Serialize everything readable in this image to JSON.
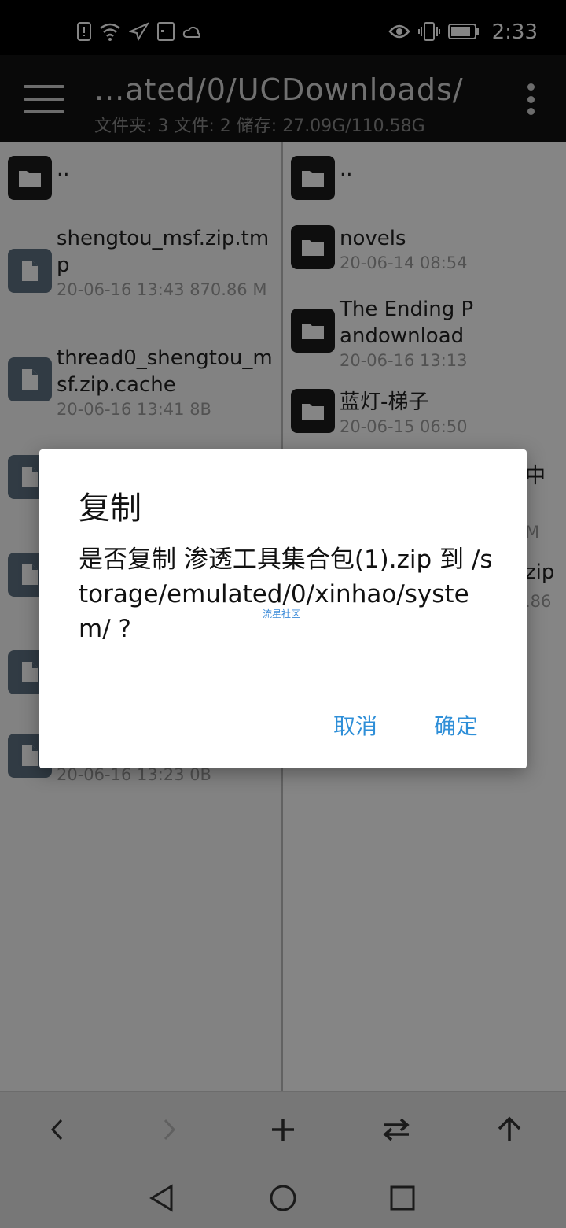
{
  "status_bar": {
    "time": "2:33",
    "left_icons": [
      "alert-icon",
      "wifi-icon",
      "airplane-icon",
      "sim-icon",
      "weather-icon"
    ],
    "right_icons": [
      "eye-icon",
      "vibrate-icon",
      "battery-icon"
    ]
  },
  "toolbar": {
    "path": "...ated/0/UCDownloads/",
    "stats": "文件夹: 3  文件: 2  储存: 27.09G/110.58G"
  },
  "left_pane": {
    "items": [
      {
        "name": "..",
        "meta": "",
        "type": "folder"
      },
      {
        "name": "shengtou_msf.zip.tmp",
        "meta": "20-06-16 13:43  870.86 M",
        "type": "file"
      },
      {
        "name": "thread0_shengtou_msf.zip.cache",
        "meta": "20-06-16 13:41  8B",
        "type": "file"
      },
      {
        "name": "",
        "meta": "",
        "type": "file"
      },
      {
        "name": "",
        "meta": "",
        "type": "file"
      },
      {
        "name": "",
        "meta": "",
        "type": "file"
      },
      {
        "name": "",
        "meta": "20-06-16 13:23  0B",
        "type": "file"
      }
    ]
  },
  "right_pane": {
    "items": [
      {
        "name": "..",
        "meta": "",
        "type": "folder"
      },
      {
        "name": "novels",
        "meta": "20-06-14 08:54",
        "type": "folder"
      },
      {
        "name": "The Ending Pandownload",
        "meta": "20-06-16 13:13",
        "type": "folder"
      },
      {
        "name": "蓝灯-梯子",
        "meta": "20-06-15 06:50",
        "type": "folder"
      }
    ],
    "partial": [
      "中",
      "M",
      "zip",
      ".86"
    ]
  },
  "dialog": {
    "title": "复制",
    "message": "是否复制 渗透工具集合包(1).zip 到 /storage/emulated/0/xinhao/system/ ?",
    "watermark": "流星社区",
    "cancel": "取消",
    "ok": "确定"
  },
  "bottom_bar": [
    "back-icon",
    "forward-icon",
    "add-icon",
    "swap-icon",
    "up-icon"
  ],
  "nav_bar": [
    "nav-back-icon",
    "nav-home-icon",
    "nav-recents-icon"
  ]
}
